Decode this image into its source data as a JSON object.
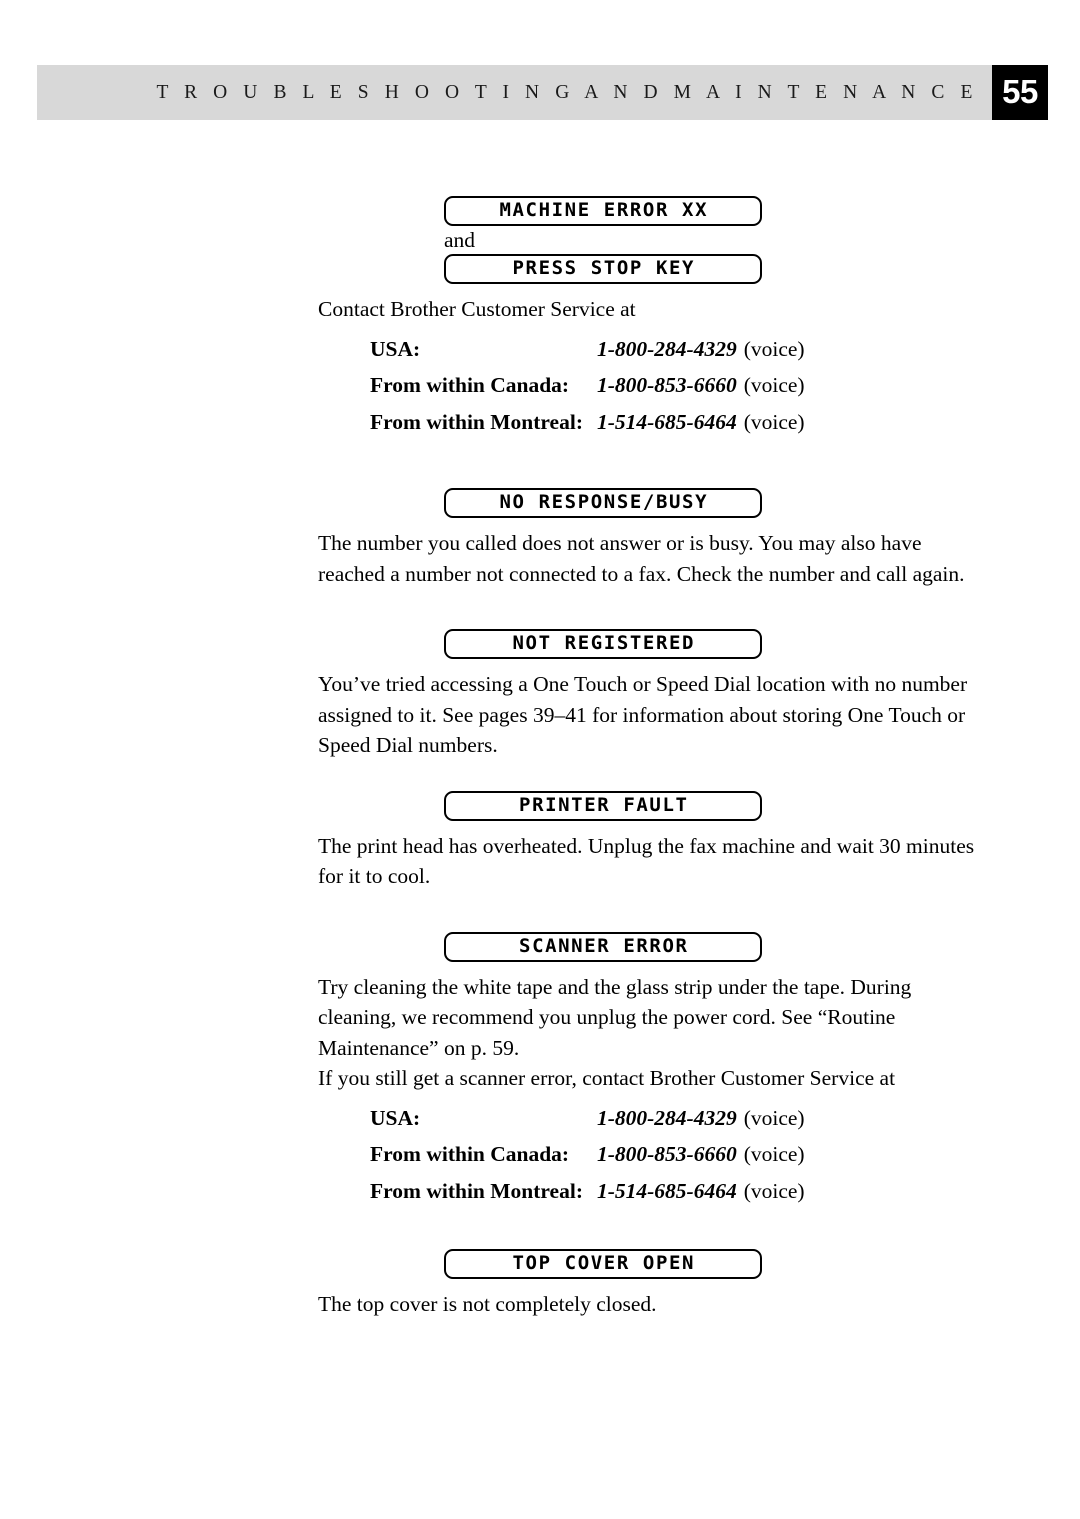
{
  "header": {
    "title": "T R O U B L E S H O O T I N G   A N D   M A I N T E N A N C E",
    "page_number": "55"
  },
  "contact_intro": "Contact Brother Customer Service at",
  "contacts": [
    {
      "label": "USA:",
      "number": "1-800-284-4329",
      "note": "(voice)"
    },
    {
      "label": "From within Canada:",
      "number": "1-800-853-6660",
      "note": "(voice)"
    },
    {
      "label": "From within Montreal:",
      "number": "1-514-685-6464",
      "note": "(voice)"
    }
  ],
  "sections": {
    "machine_error": {
      "lcd1": "MACHINE ERROR XX",
      "conjunction": "and",
      "lcd2": "PRESS STOP KEY"
    },
    "no_response_busy": {
      "lcd": "NO RESPONSE/BUSY",
      "body": "The number you called does not answer or is busy. You may also have reached a number not connected to a fax. Check the number and call again."
    },
    "not_registered": {
      "lcd": "NOT REGISTERED",
      "body": "You’ve tried accessing a One Touch or Speed Dial location with no number assigned to it. See pages 39–41 for information about storing One Touch or Speed Dial numbers."
    },
    "printer_fault": {
      "lcd": "PRINTER FAULT",
      "body": "The print head has overheated. Unplug the fax machine and wait 30 minutes for it to cool."
    },
    "scanner_error": {
      "lcd": "SCANNER ERROR",
      "body": "Try cleaning the white tape and the glass strip under the tape. During cleaning, we recommend you unplug the power cord. See “Routine Maintenance” on p. 59.",
      "body2": "If you still get a scanner error, contact Brother Customer Service at"
    },
    "top_cover_open": {
      "lcd": "TOP COVER OPEN",
      "body": "The top cover is not completely closed."
    }
  }
}
